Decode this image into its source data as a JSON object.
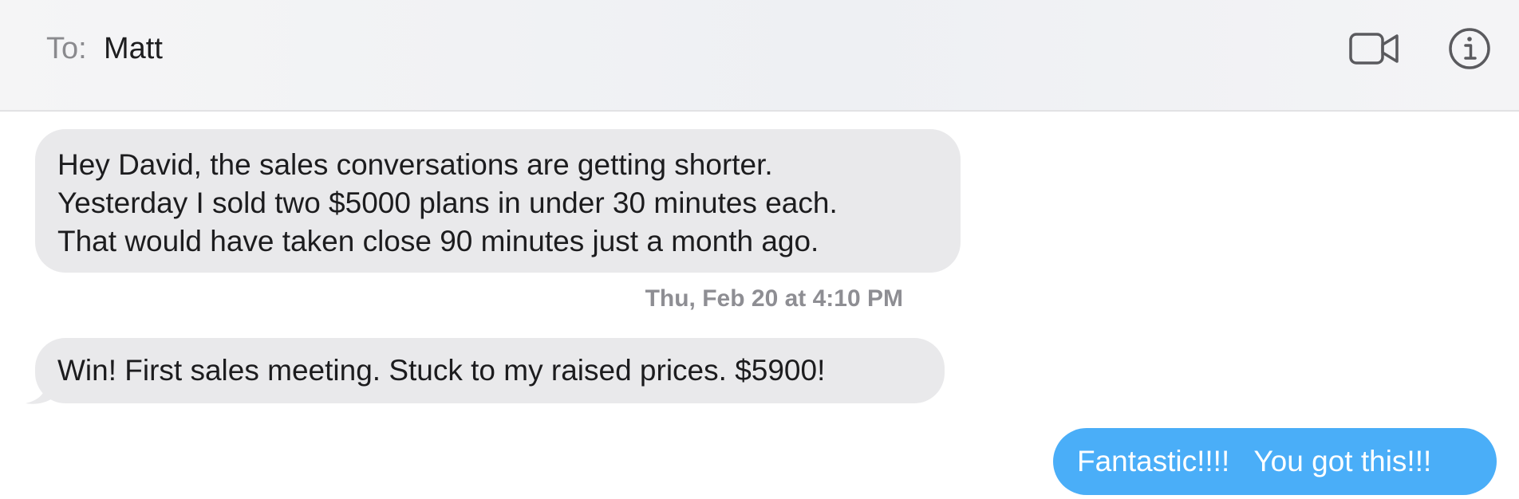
{
  "header": {
    "to_label": "To:",
    "recipient": "Matt",
    "video_icon": "video-camera-icon",
    "info_icon": "info-icon"
  },
  "messages": [
    {
      "direction": "incoming",
      "text": "Hey David, the sales conversations are getting shorter.\nYesterday I sold two $5000 plans in under 30 minutes each.\nThat would have taken close 90 minutes just a month ago."
    },
    {
      "direction": "incoming",
      "text": "Win! First sales meeting. Stuck to my raised prices. $5900!"
    },
    {
      "direction": "outgoing",
      "text": "Fantastic!!!!   You got this!!!"
    }
  ],
  "timestamp": "Thu, Feb 20 at 4:10 PM",
  "colors": {
    "incoming_bubble": "#e9e9eb",
    "outgoing_bubble": "#4aaef8",
    "timestamp_text": "#8e8e93"
  }
}
